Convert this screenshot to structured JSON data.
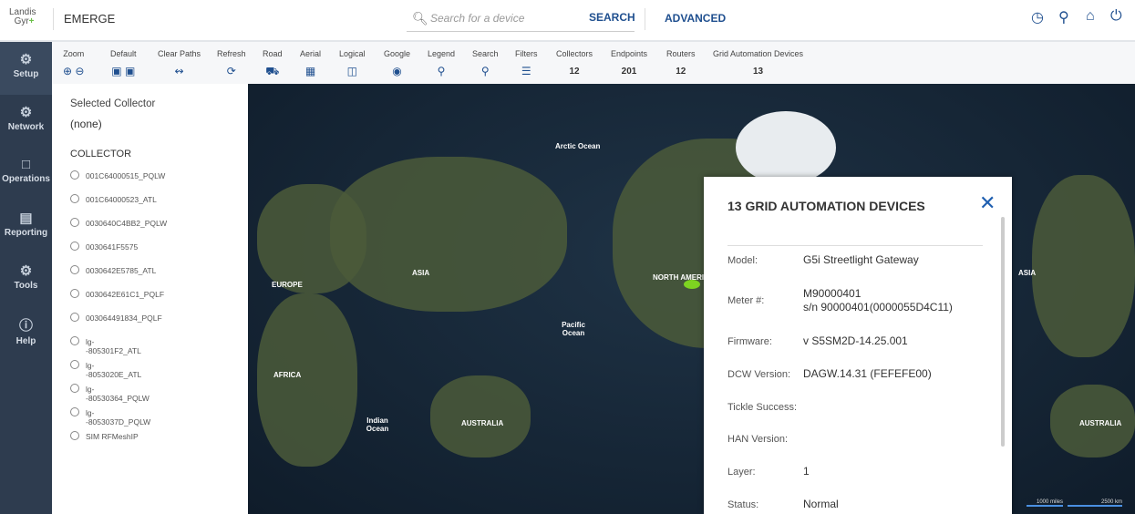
{
  "header": {
    "logo_line1": "Landis",
    "logo_line2": "Gyr",
    "logo_plus": "+",
    "app_name": "EMERGE",
    "search_placeholder": "Search for a device",
    "search_button": "SEARCH",
    "advanced": "ADVANCED"
  },
  "sidebar": [
    {
      "icon": "gear-icon",
      "label": "Setup"
    },
    {
      "icon": "network-icon",
      "label": "Network"
    },
    {
      "icon": "folder-icon",
      "label": "Operations"
    },
    {
      "icon": "clipboard-icon",
      "label": "Reporting"
    },
    {
      "icon": "tools-icon",
      "label": "Tools"
    },
    {
      "icon": "help-icon",
      "label": "Help"
    }
  ],
  "toolbar": {
    "zoom": "Zoom",
    "default": "Default",
    "clear_paths": "Clear Paths",
    "refresh": "Refresh",
    "road": "Road",
    "aerial": "Aerial",
    "logical": "Logical",
    "google": "Google",
    "legend": "Legend",
    "search": "Search",
    "filters": "Filters",
    "collectors": "Collectors",
    "collectors_count": "12",
    "endpoints": "Endpoints",
    "endpoints_count": "201",
    "routers": "Routers",
    "routers_count": "12",
    "gad": "Grid Automation Devices",
    "gad_count": "13"
  },
  "panel": {
    "selected_label": "Selected Collector",
    "selected_value": "(none)",
    "collector_heading": "COLLECTOR",
    "collectors": [
      "001C64000515_PQLW",
      "001C64000523_ATL",
      "0030640C4BB2_PQLW",
      "0030641F5575",
      "0030642E5785_ATL",
      "0030642E61C1_PQLF",
      "003064491834_PQLF"
    ],
    "lg_prefix": "lg-",
    "lg_collectors": [
      "-805301F2_ATL",
      "-8053020E_ATL",
      "-80530364_PQLW",
      "-8053037D_PQLW"
    ],
    "last": "SIM RFMeshIP"
  },
  "map": {
    "labels": {
      "arctic": "Arctic Ocean",
      "europe": "EUROPE",
      "asia": "ASIA",
      "north_america": "NORTH AMERICA",
      "pacific": "Pacific Ocean",
      "africa": "AFRICA",
      "indian": "Indian Ocean",
      "australia": "AUSTRALIA",
      "asia2": "ASIA",
      "australia2": "AUSTRALIA"
    },
    "scale_miles": "1000 miles",
    "scale_km": "2500 km"
  },
  "details": {
    "title": "13 GRID AUTOMATION DEVICES",
    "fields": [
      {
        "k": "Model:",
        "v": "G5i Streetlight Gateway"
      },
      {
        "k": "Meter #:",
        "v": "M90000401",
        "v2": "s/n 90000401(0000055D4C11)"
      },
      {
        "k": "Firmware:",
        "v": "v S5SM2D-14.25.001"
      },
      {
        "k": "DCW Version:",
        "v": "DAGW.14.31 (FEFEFE00)"
      },
      {
        "k": "Tickle Success:",
        "v": ""
      },
      {
        "k": "HAN Version:",
        "v": ""
      },
      {
        "k": "Layer:",
        "v": "1"
      },
      {
        "k": "Status:",
        "v": "Normal"
      }
    ]
  }
}
